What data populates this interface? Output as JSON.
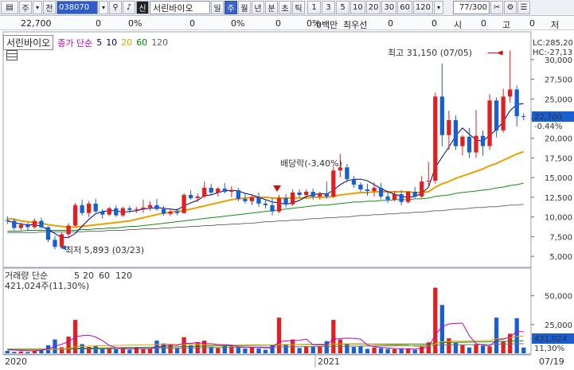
{
  "toolbar": {
    "type_label": "주",
    "full_label": "전",
    "code": "038070",
    "search_icon": "search-icon",
    "sound_icon": "speaker-icon",
    "new_label": "신",
    "stock_name": "서린바이오",
    "periods": [
      "일",
      "주",
      "월",
      "년",
      "분",
      "초",
      "틱"
    ],
    "selected_period": "주",
    "intervals": [
      "1",
      "3",
      "5",
      "10",
      "20",
      "30",
      "60",
      "120"
    ],
    "count": "77",
    "total": "/300",
    "icons": [
      "scissors-icon",
      "settings-icon",
      "stack-icon"
    ]
  },
  "info": {
    "price": "22,700",
    "v1": "0",
    "pct1": "0%",
    "v2": "0",
    "pct2": "0%",
    "v3": "0",
    "pct3": "0%",
    "vol": "0백만",
    "best_label": "최우선",
    "v4": "0",
    "si_label": "시",
    "v5": "0",
    "go_label": "고",
    "v6": "0",
    "jeo_label": "저"
  },
  "price_panel": {
    "tab": "서린바이오",
    "legend_main": "종가 단순",
    "ma_periods": [
      "5",
      "10",
      "20",
      "60",
      "120"
    ],
    "ma_colors": [
      "#000080",
      "#000080",
      "#e8a000",
      "#008000",
      "#606060"
    ],
    "lc_label": "LC:285,20",
    "hc_label": "HC:-27,13",
    "current_price": "22,700",
    "current_pct": "-0.44%",
    "high_annotation": "최고 31,150 (07/05)",
    "low_annotation": "최저 5,893 (03/23)",
    "dividend_annotation": "배당락(-3,40%)"
  },
  "volume_panel": {
    "legend_main": "거래량 단순",
    "ma_periods": [
      "5",
      "20",
      "60",
      "120"
    ],
    "ma_colors": [
      "#c000c0",
      "#e8a000",
      "#008000",
      "#606060"
    ],
    "current_volume": "421,024주(11,30%)",
    "current_volume_box": "421,024",
    "current_volume_pct": "11,30%"
  },
  "x_axis": {
    "labels": [
      "2020",
      "2021",
      "07/19"
    ]
  },
  "colors": {
    "up": "#e02020",
    "down": "#1a5fd0",
    "accent": "#2f5cc6"
  },
  "chart_data": [
    {
      "type": "candlestick",
      "title": "서린바이오",
      "ylim": [
        4000,
        31500
      ],
      "yticks": [
        5000,
        7500,
        10000,
        12500,
        15000,
        17500,
        20000,
        22500,
        25000,
        27500,
        30000
      ],
      "ytick_labels": [
        "5,000",
        "7,500",
        "10,000",
        "12,500",
        "15,000",
        "17,500",
        "20,000",
        "22,500",
        "25,000",
        "27,500",
        "30,000"
      ],
      "candles": [
        [
          9600,
          10100,
          9100,
          9500
        ],
        [
          9500,
          9800,
          8300,
          8600
        ],
        [
          8600,
          9300,
          8300,
          9000
        ],
        [
          9000,
          9300,
          8200,
          8700
        ],
        [
          8700,
          9800,
          8500,
          9500
        ],
        [
          9500,
          9900,
          8500,
          8700
        ],
        [
          8700,
          8800,
          6800,
          7100
        ],
        [
          7100,
          7600,
          5893,
          6200
        ],
        [
          6200,
          8000,
          6000,
          7800
        ],
        [
          7800,
          9200,
          7500,
          8900
        ],
        [
          8900,
          11800,
          8700,
          11500
        ],
        [
          11500,
          12200,
          10200,
          10500
        ],
        [
          10500,
          12000,
          10000,
          11700
        ],
        [
          11700,
          12300,
          10500,
          10700
        ],
        [
          10700,
          11000,
          9800,
          10300
        ],
        [
          10300,
          11300,
          10100,
          11100
        ],
        [
          11100,
          11500,
          10000,
          10200
        ],
        [
          10200,
          11300,
          10000,
          11100
        ],
        [
          11100,
          11400,
          10500,
          10900
        ],
        [
          10900,
          11300,
          10500,
          11000
        ],
        [
          11000,
          12200,
          10500,
          11200
        ],
        [
          11200,
          12000,
          10800,
          11500
        ],
        [
          11500,
          12300,
          10800,
          11000
        ],
        [
          11000,
          11400,
          10200,
          10400
        ],
        [
          10400,
          11000,
          10100,
          10700
        ],
        [
          10700,
          11100,
          10200,
          10500
        ],
        [
          10500,
          13000,
          10400,
          12800
        ],
        [
          12800,
          13400,
          12200,
          12400
        ],
        [
          12400,
          13000,
          11900,
          12600
        ],
        [
          12600,
          14500,
          12400,
          13700
        ],
        [
          13700,
          14200,
          12800,
          13100
        ],
        [
          13100,
          13800,
          12600,
          13600
        ],
        [
          13600,
          14300,
          13000,
          13200
        ],
        [
          13200,
          13900,
          12500,
          13400
        ],
        [
          13400,
          13700,
          12000,
          12300
        ],
        [
          12300,
          12900,
          11700,
          12000
        ],
        [
          12000,
          12800,
          11500,
          12500
        ],
        [
          12500,
          13100,
          11300,
          11700
        ],
        [
          11700,
          12100,
          11100,
          11500
        ],
        [
          11500,
          12400,
          10200,
          10700
        ],
        [
          10700,
          12800,
          10500,
          12400
        ],
        [
          12400,
          12900,
          11200,
          11600
        ],
        [
          11600,
          13500,
          11400,
          13100
        ],
        [
          13100,
          13500,
          12500,
          12800
        ],
        [
          12800,
          13500,
          12400,
          13200
        ],
        [
          13200,
          13600,
          12200,
          12600
        ],
        [
          12600,
          13200,
          12200,
          13000
        ],
        [
          13000,
          14500,
          12300,
          12600
        ],
        [
          12600,
          16400,
          12400,
          15900
        ],
        [
          15900,
          18000,
          15000,
          16300
        ],
        [
          16300,
          16700,
          14400,
          14800
        ],
        [
          14800,
          15200,
          13700,
          14100
        ],
        [
          14100,
          14400,
          13200,
          13500
        ],
        [
          13500,
          14200,
          12700,
          13300
        ],
        [
          13300,
          14400,
          12600,
          13700
        ],
        [
          13700,
          14300,
          12300,
          12600
        ],
        [
          12600,
          13100,
          11800,
          12200
        ],
        [
          12200,
          13300,
          12000,
          12900
        ],
        [
          12900,
          13400,
          11500,
          11900
        ],
        [
          11900,
          13300,
          11700,
          13200
        ],
        [
          13200,
          13800,
          12400,
          12600
        ],
        [
          12600,
          15200,
          12400,
          14500
        ],
        [
          14500,
          17000,
          13800,
          14600
        ],
        [
          14600,
          25800,
          14200,
          25300
        ],
        [
          25300,
          29500,
          19000,
          20400
        ],
        [
          20400,
          23500,
          18500,
          22300
        ],
        [
          22300,
          22900,
          18500,
          19000
        ],
        [
          19000,
          20400,
          17800,
          20200
        ],
        [
          20200,
          21300,
          17500,
          18200
        ],
        [
          18200,
          23600,
          17500,
          20300
        ],
        [
          20300,
          21000,
          17800,
          19000
        ],
        [
          19000,
          25600,
          18500,
          24800
        ],
        [
          24800,
          25200,
          20100,
          21000
        ],
        [
          21000,
          26300,
          20700,
          25300
        ],
        [
          25300,
          31150,
          24500,
          26200
        ],
        [
          26200,
          26700,
          21500,
          22800
        ],
        [
          22800,
          23200,
          22300,
          22700
        ]
      ],
      "ma5": [
        9500,
        9300,
        9100,
        9000,
        9000,
        8800,
        8400,
        7900,
        7400,
        7400,
        7900,
        8800,
        9700,
        10400,
        10700,
        10800,
        10800,
        10600,
        10700,
        10800,
        11000,
        11100,
        11200,
        11100,
        11000,
        10900,
        11400,
        11800,
        12100,
        12700,
        12800,
        13100,
        13300,
        13400,
        13300,
        13000,
        12800,
        12500,
        12200,
        11900,
        11800,
        11600,
        11800,
        12100,
        12600,
        12800,
        13000,
        12900,
        13400,
        14100,
        14600,
        14800,
        14800,
        14600,
        14100,
        13600,
        13200,
        12900,
        12600,
        12500,
        12600,
        13000,
        13800,
        16300,
        17600,
        18900,
        20300,
        21300,
        20500,
        19800,
        19600,
        20400,
        21100,
        22100,
        23500,
        24300,
        24400
      ],
      "ma20": [
        9800,
        9700,
        9500,
        9400,
        9300,
        9200,
        9000,
        8900,
        8800,
        8700,
        8700,
        8800,
        8900,
        9000,
        9100,
        9200,
        9300,
        9400,
        9500,
        9700,
        9900,
        10100,
        10300,
        10500,
        10600,
        10700,
        10800,
        11000,
        11200,
        11400,
        11600,
        11800,
        12000,
        12200,
        12300,
        12400,
        12500,
        12500,
        12500,
        12400,
        12400,
        12400,
        12400,
        12400,
        12400,
        12500,
        12500,
        12500,
        12600,
        12800,
        12900,
        13000,
        13100,
        13100,
        13200,
        13200,
        13200,
        13200,
        13200,
        13200,
        13100,
        13100,
        13200,
        13800,
        14200,
        14500,
        14900,
        15200,
        15500,
        15800,
        16100,
        16500,
        16800,
        17200,
        17600,
        18000,
        18300
      ],
      "ma60": [
        8200,
        8200,
        8200,
        8300,
        8300,
        8300,
        8300,
        8300,
        8300,
        8300,
        8300,
        8400,
        8400,
        8500,
        8500,
        8600,
        8600,
        8700,
        8800,
        8800,
        8900,
        9000,
        9100,
        9200,
        9300,
        9400,
        9500,
        9600,
        9700,
        9800,
        9900,
        10000,
        10100,
        10200,
        10300,
        10400,
        10500,
        10600,
        10700,
        10800,
        10900,
        11000,
        11100,
        11200,
        11300,
        11400,
        11500,
        11500,
        11600,
        11700,
        11800,
        11900,
        11900,
        12000,
        12000,
        12100,
        12100,
        12200,
        12200,
        12200,
        12300,
        12300,
        12400,
        12600,
        12700,
        12800,
        13000,
        13100,
        13200,
        13300,
        13400,
        13500,
        13700,
        13800,
        14000,
        14100,
        14300
      ],
      "ma120": [
        8000,
        8000,
        8000,
        8000,
        8000,
        8100,
        8100,
        8100,
        8100,
        8100,
        8100,
        8100,
        8200,
        8200,
        8200,
        8300,
        8300,
        8300,
        8400,
        8400,
        8500,
        8500,
        8500,
        8600,
        8600,
        8700,
        8700,
        8800,
        8800,
        8900,
        8900,
        9000,
        9000,
        9100,
        9100,
        9200,
        9200,
        9300,
        9400,
        9400,
        9500,
        9500,
        9600,
        9600,
        9700,
        9800,
        9800,
        9900,
        9900,
        10000,
        10000,
        10100,
        10200,
        10200,
        10300,
        10300,
        10400,
        10400,
        10500,
        10500,
        10600,
        10600,
        10700,
        10800,
        10800,
        10900,
        11000,
        11000,
        11100,
        11200,
        11200,
        11300,
        11300,
        11400,
        11500,
        11500,
        11600
      ]
    },
    {
      "type": "bar",
      "title": "거래량",
      "ylim": [
        0,
        65000
      ],
      "yticks": [
        25000,
        50000
      ],
      "ytick_labels": [
        "25,000",
        "50,000"
      ],
      "volumes": [
        2100,
        1200,
        1500,
        1100,
        2400,
        3100,
        7000,
        12000,
        5200,
        14500,
        29000,
        8000,
        5500,
        6200,
        3900,
        4800,
        3500,
        4000,
        3200,
        5300,
        3500,
        3800,
        11000,
        8600,
        7500,
        4200,
        14000,
        7000,
        9500,
        11000,
        5500,
        4500,
        6800,
        6000,
        5200,
        4100,
        5000,
        4300,
        3100,
        7500,
        31000,
        8000,
        12000,
        4600,
        6200,
        5700,
        5500,
        10500,
        29000,
        12000,
        8000,
        5500,
        6500,
        3800,
        5000,
        4500,
        3800,
        3600,
        3700,
        4000,
        3100,
        5800,
        9500,
        57000,
        42000,
        13000,
        9000,
        7000,
        5000,
        8000,
        6500,
        6000,
        31000,
        10500,
        17000,
        30500,
        5000
      ],
      "ma5": [
        3000,
        2800,
        2500,
        2200,
        2100,
        2700,
        3900,
        6100,
        7900,
        10000,
        14300,
        15300,
        15800,
        14200,
        11000,
        6800,
        4900,
        4500,
        4000,
        4100,
        4000,
        4100,
        5500,
        6600,
        7100,
        6900,
        8700,
        8600,
        9400,
        8500,
        8400,
        7600,
        7400,
        7000,
        5700,
        5300,
        5400,
        5200,
        4700,
        4800,
        10000,
        10700,
        11100,
        11300,
        12400,
        7300,
        7200,
        7400,
        12400,
        12700,
        13200,
        13000,
        12300,
        7200,
        5800,
        5100,
        4700,
        4100,
        4100,
        3900,
        3600,
        4400,
        5400,
        16000,
        23100,
        25500,
        26100,
        26100,
        15200,
        8400,
        7100,
        6500,
        11300,
        12400,
        14200,
        19000,
        18700
      ],
      "ma20": [
        3000,
        3000,
        3000,
        3000,
        3000,
        3100,
        3200,
        3500,
        3700,
        4300,
        5600,
        6000,
        6200,
        6500,
        6600,
        6800,
        6900,
        7000,
        7100,
        7200,
        7300,
        7400,
        7800,
        8000,
        8000,
        7700,
        8000,
        7900,
        7900,
        7400,
        7200,
        7000,
        7100,
        7100,
        7200,
        7200,
        7300,
        7300,
        7200,
        7300,
        7800,
        7600,
        7700,
        7500,
        7400,
        7500,
        7400,
        7400,
        8100,
        8100,
        8200,
        8300,
        8300,
        8100,
        7700,
        7600,
        7400,
        7300,
        7100,
        7000,
        6100,
        6000,
        6000,
        8300,
        10000,
        10300,
        10500,
        10600,
        10700,
        10900,
        11100,
        11200,
        12500,
        12800,
        13500,
        14800,
        14800
      ],
      "ma60": [
        3500,
        3500,
        3500,
        3500,
        3500,
        3500,
        3600,
        3700,
        3800,
        3900,
        4200,
        4300,
        4400,
        4500,
        4600,
        4700,
        4800,
        4900,
        5000,
        5100,
        5200,
        5300,
        5400,
        5500,
        5600,
        5700,
        5900,
        6000,
        6100,
        6200,
        6300,
        6400,
        6500,
        6600,
        6700,
        6800,
        6900,
        7000,
        7100,
        7200,
        7400,
        7500,
        7600,
        7600,
        7700,
        7700,
        7800,
        7800,
        7900,
        7900,
        8000,
        8000,
        8000,
        8000,
        8000,
        8000,
        8000,
        8000,
        8000,
        8000,
        8000,
        8000,
        8000,
        8800,
        9300,
        9400,
        9500,
        9600,
        9700,
        9800,
        9900,
        10000,
        10300,
        10400,
        10600,
        10900,
        10900
      ],
      "ma120": [
        3500,
        3500,
        3500,
        3500,
        3500,
        3500,
        3500,
        3500,
        3600,
        3600,
        3700,
        3700,
        3800,
        3800,
        3900,
        3900,
        4000,
        4000,
        4100,
        4100,
        4200,
        4200,
        4300,
        4400,
        4400,
        4500,
        4600,
        4600,
        4700,
        4800,
        4800,
        4900,
        5000,
        5000,
        5100,
        5100,
        5200,
        5300,
        5300,
        5400,
        5500,
        5600,
        5700,
        5700,
        5800,
        5800,
        5900,
        5900,
        6000,
        6100,
        6100,
        6200,
        6200,
        6300,
        6300,
        6400,
        6400,
        6500,
        6500,
        6600,
        6600,
        6700,
        6700,
        7000,
        7200,
        7300,
        7400,
        7400,
        7500,
        7600,
        7700,
        7700,
        7900,
        8000,
        8100,
        8300,
        8300
      ]
    }
  ]
}
